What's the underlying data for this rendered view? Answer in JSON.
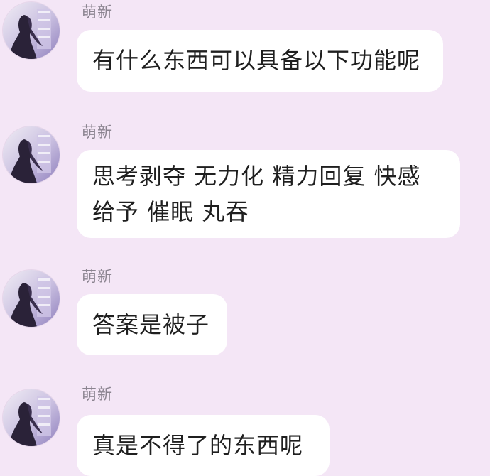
{
  "messages": [
    {
      "sender": "萌新",
      "lines": [
        "有什么东西可以具备以下功能呢"
      ]
    },
    {
      "sender": "萌新",
      "lines": [
        "思考剥夺 无力化 精力回复 快感",
        "给予 催眠 丸吞"
      ]
    },
    {
      "sender": "萌新",
      "lines": [
        "答案是被子"
      ]
    },
    {
      "sender": "萌新",
      "lines": [
        "真是不得了的东西呢"
      ]
    }
  ],
  "colors": {
    "background": "#f4e6f6",
    "bubble": "#ffffff",
    "sender_name": "#8b8490",
    "message_text": "#1f1f1f"
  },
  "icons": {
    "avatar": "girl-silhouette-avatar-icon"
  }
}
